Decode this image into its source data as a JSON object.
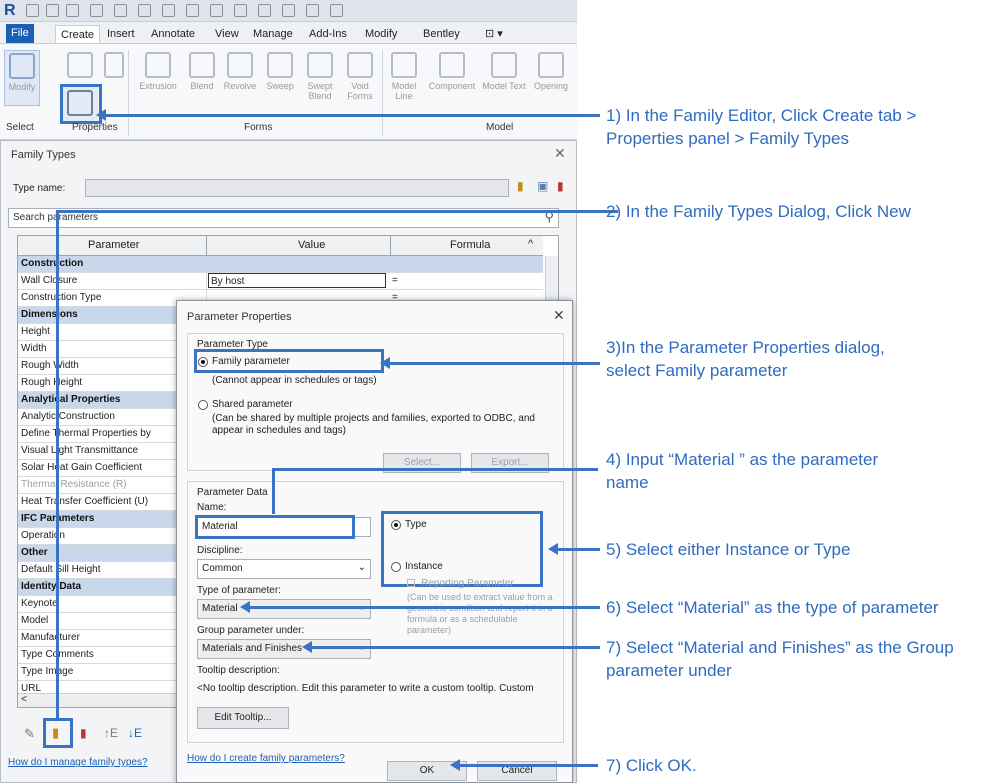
{
  "ribbon": {
    "tabs": [
      "File",
      "Create",
      "Insert",
      "Annotate",
      "View",
      "Manage",
      "Add-Ins",
      "Modify",
      "Bentley"
    ],
    "buttons": [
      "Modify",
      "Extrusion",
      "Blend",
      "Revolve",
      "Sweep",
      "Swept Blend",
      "Void Forms",
      "Model Line",
      "Component",
      "Model Text",
      "Opening"
    ],
    "panels": [
      "Select",
      "Properties",
      "Forms",
      "Model"
    ]
  },
  "family_types": {
    "title": "Family Types",
    "type_name_label": "Type name:",
    "search_placeholder": "Search parameters",
    "columns": [
      "Parameter",
      "Value",
      "Formula"
    ],
    "rows": [
      {
        "name": "Construction",
        "group": true
      },
      {
        "name": "Wall Closure",
        "value": "By host",
        "formula": "="
      },
      {
        "name": "Construction Type",
        "value": "",
        "formula": "="
      },
      {
        "name": "Dimensions",
        "group": true
      },
      {
        "name": "Height"
      },
      {
        "name": "Width"
      },
      {
        "name": "Rough Width"
      },
      {
        "name": "Rough Height"
      },
      {
        "name": "Analytical Properties",
        "group": true
      },
      {
        "name": "Analytic Construction"
      },
      {
        "name": "Define Thermal Properties by"
      },
      {
        "name": "Visual Light Transmittance"
      },
      {
        "name": "Solar Heat Gain Coefficient"
      },
      {
        "name": "Thermal Resistance (R)",
        "disabled": true
      },
      {
        "name": "Heat Transfer Coefficient (U)"
      },
      {
        "name": "IFC Parameters",
        "group": true
      },
      {
        "name": "Operation"
      },
      {
        "name": "Other",
        "group": true
      },
      {
        "name": "Default Sill Height"
      },
      {
        "name": "Identity Data",
        "group": true
      },
      {
        "name": "Keynote"
      },
      {
        "name": "Model"
      },
      {
        "name": "Manufacturer"
      },
      {
        "name": "Type Comments"
      },
      {
        "name": "Type Image"
      },
      {
        "name": "URL"
      }
    ],
    "help_link": "How do I manage family types?"
  },
  "param_props": {
    "title": "Parameter Properties",
    "parameter_type_label": "Parameter Type",
    "family_param": "Family parameter",
    "family_note": "(Cannot appear in schedules or tags)",
    "shared_param": "Shared parameter",
    "shared_note": "(Can be shared by multiple projects and families, exported to ODBC, and appear in schedules and tags)",
    "select_btn": "Select...",
    "export_btn": "Export...",
    "param_data_label": "Parameter Data",
    "name_label": "Name:",
    "name_value": "Material",
    "type_radio": "Type",
    "instance_radio": "Instance",
    "reporting": "Reporting Parameter",
    "reporting_note": "(Can be used to extract value from a geometric condition and report it in a formula or as a schedulable parameter)",
    "discipline_label": "Discipline:",
    "discipline_value": "Common",
    "type_of_param_label": "Type of parameter:",
    "type_of_param_value": "Material",
    "group_label": "Group parameter under:",
    "group_value": "Materials and Finishes",
    "tooltip_label": "Tooltip description:",
    "tooltip_value": "<No tooltip description. Edit this parameter to write a custom tooltip. Custom",
    "edit_tooltip_btn": "Edit Tooltip...",
    "help_link": "How do I create family parameters?",
    "ok": "OK",
    "cancel": "Cancel"
  },
  "annotations": [
    "1) In the Family Editor, Click Create tab >",
    "Properties panel > Family Types",
    "2) In the Family Types Dialog, Click New",
    "3)In the Parameter Properties dialog,",
    "select Family parameter",
    "4) Input “Material ” as the parameter",
    "name",
    "5) Select either Instance or Type",
    "6) Select “Material” as the type of parameter",
    "7) Select “Material and Finishes” as the Group",
    "parameter under",
    "7) Click OK."
  ],
  "colors": {
    "accent": "#3a73c4",
    "file_tab": "#1b5fb5",
    "group_row": "#c9d7ea"
  }
}
